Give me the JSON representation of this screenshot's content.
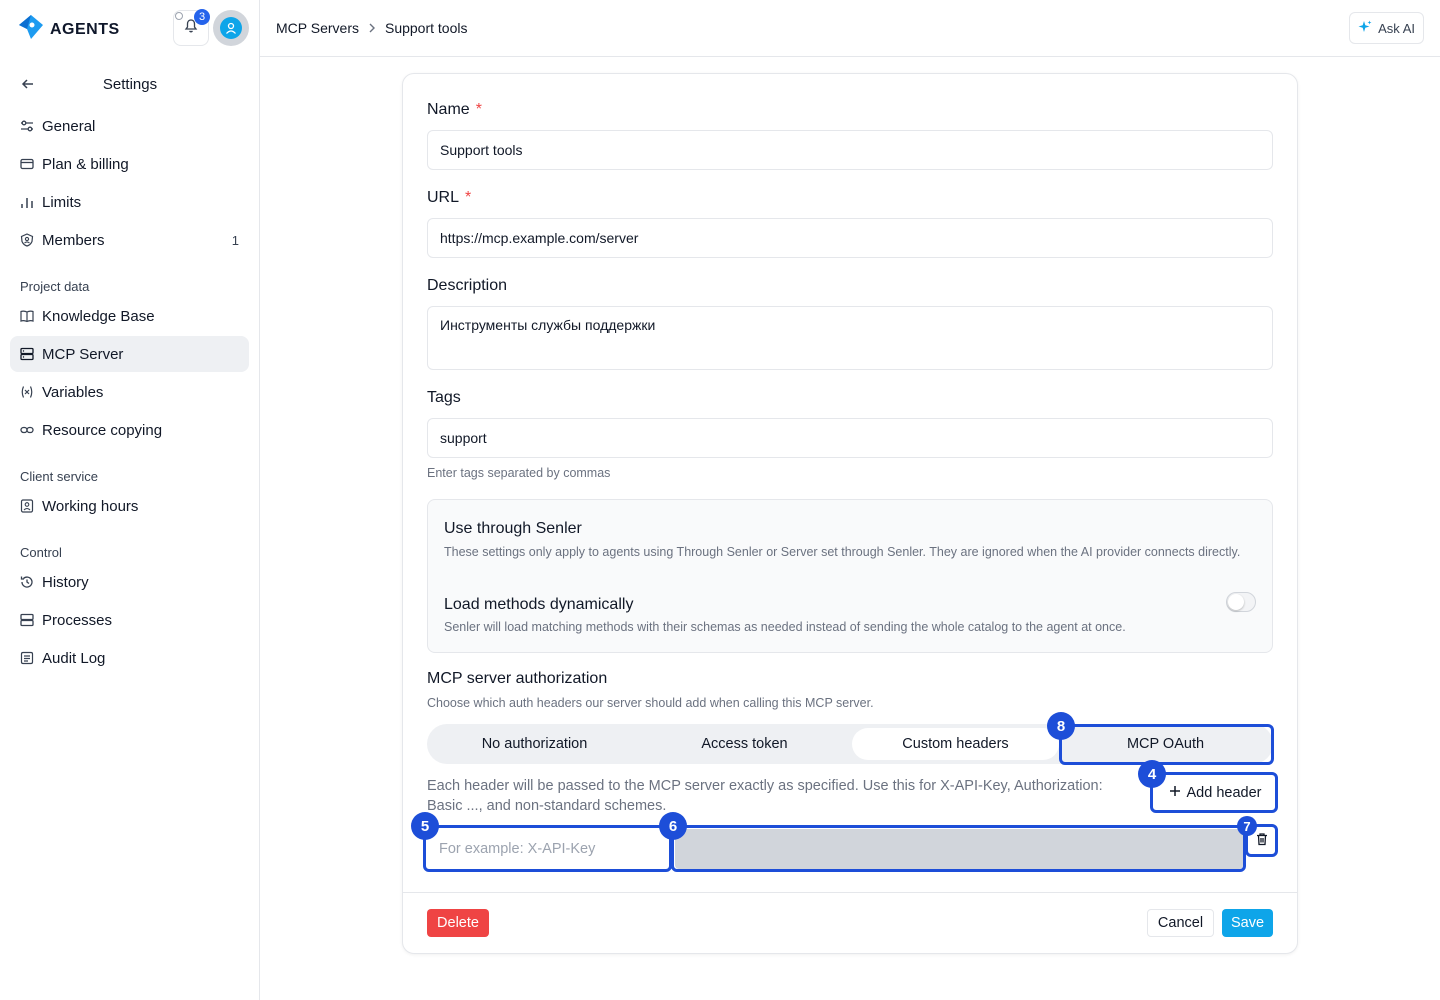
{
  "app": {
    "logo_text": "AGENTS",
    "notifications_count": "3",
    "accent_color": "#2563eb",
    "brand_color": "#0ea5e9"
  },
  "sidebar": {
    "title": "Settings",
    "items": [
      {
        "label": "General",
        "icon": "sliders-icon"
      },
      {
        "label": "Plan & billing",
        "icon": "credit-card-icon"
      },
      {
        "label": "Limits",
        "icon": "bar-chart-icon"
      },
      {
        "label": "Members",
        "icon": "shield-user-icon",
        "count": "1"
      }
    ],
    "groups": [
      {
        "label": "Project data",
        "items": [
          {
            "label": "Knowledge Base",
            "icon": "book-icon"
          },
          {
            "label": "MCP Server",
            "icon": "server-icon",
            "active": true
          },
          {
            "label": "Variables",
            "icon": "variable-icon"
          },
          {
            "label": "Resource copying",
            "icon": "link-icon"
          }
        ]
      },
      {
        "label": "Client service",
        "items": [
          {
            "label": "Working hours",
            "icon": "clock-user-icon"
          }
        ]
      },
      {
        "label": "Control",
        "items": [
          {
            "label": "History",
            "icon": "history-icon"
          },
          {
            "label": "Processes",
            "icon": "server-icon"
          },
          {
            "label": "Audit Log",
            "icon": "scroll-icon"
          }
        ]
      }
    ]
  },
  "topbar": {
    "breadcrumb": [
      "MCP Servers",
      "Support tools"
    ],
    "ask_ai": "Ask AI"
  },
  "form": {
    "name_label": "Name",
    "name_value": "Support tools",
    "url_label": "URL",
    "url_value": "https://mcp.example.com/server",
    "description_label": "Description",
    "description_value": "Инструменты службы поддержки",
    "tags_label": "Tags",
    "tags_value": "support",
    "tags_hint": "Enter tags separated by commas",
    "required_mark": "*"
  },
  "senler": {
    "title": "Use through Senler",
    "description": "These settings only apply to agents using Through Senler or Server set through Senler. They are ignored when the AI provider connects directly.",
    "dynamic_title": "Load methods dynamically",
    "dynamic_description": "Senler will load matching methods with their schemas as needed instead of sending the whole catalog to the agent at once.",
    "dynamic_enabled": false
  },
  "auth": {
    "title": "MCP server authorization",
    "description": "Choose which auth headers our server should add when calling this MCP server.",
    "options": [
      "No authorization",
      "Access token",
      "Custom headers",
      "MCP OAuth"
    ],
    "selected": "Custom headers",
    "headers_description": "Each header will be passed to the MCP server exactly as specified. Use this for X-API-Key, Authorization: Basic ..., and non-standard schemes.",
    "add_header": "Add header",
    "key_placeholder": "For example: X-API-Key"
  },
  "markers": [
    "8",
    "4",
    "5",
    "6",
    "7"
  ],
  "footer": {
    "delete": "Delete",
    "cancel": "Cancel",
    "save": "Save"
  }
}
